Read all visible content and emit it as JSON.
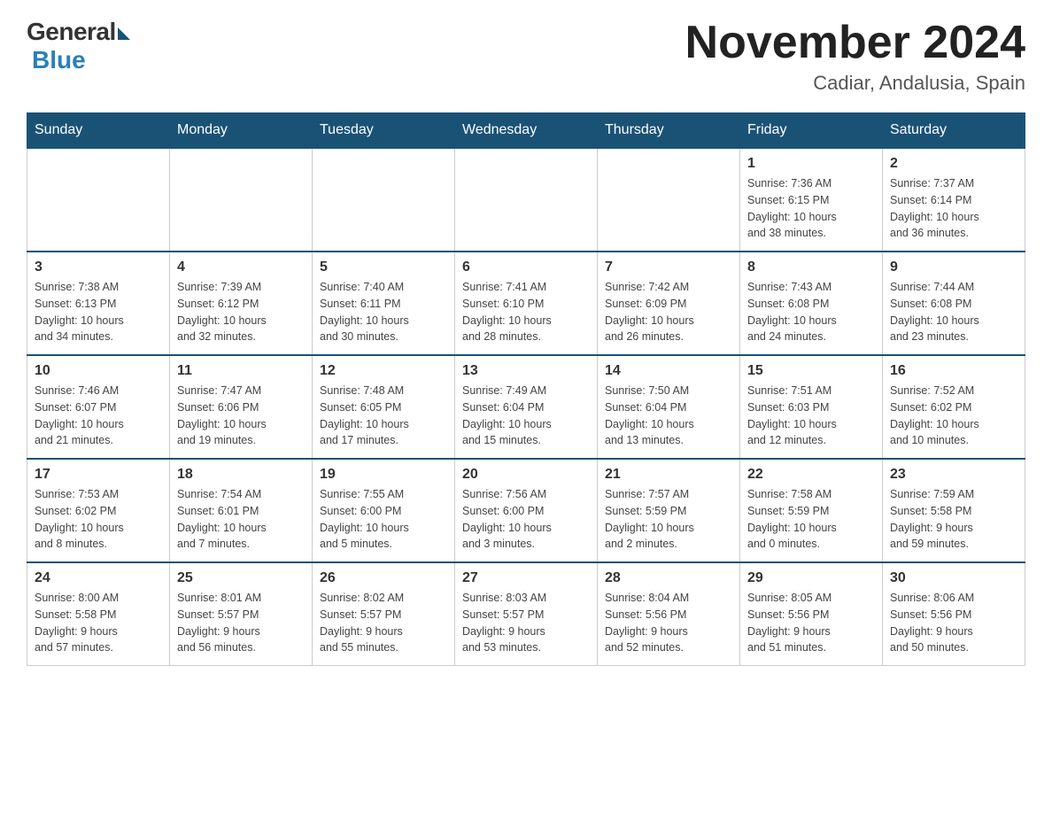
{
  "logo": {
    "general": "General",
    "blue": "Blue"
  },
  "title": "November 2024",
  "subtitle": "Cadiar, Andalusia, Spain",
  "weekdays": [
    "Sunday",
    "Monday",
    "Tuesday",
    "Wednesday",
    "Thursday",
    "Friday",
    "Saturday"
  ],
  "weeks": [
    [
      {
        "day": "",
        "info": ""
      },
      {
        "day": "",
        "info": ""
      },
      {
        "day": "",
        "info": ""
      },
      {
        "day": "",
        "info": ""
      },
      {
        "day": "",
        "info": ""
      },
      {
        "day": "1",
        "info": "Sunrise: 7:36 AM\nSunset: 6:15 PM\nDaylight: 10 hours\nand 38 minutes."
      },
      {
        "day": "2",
        "info": "Sunrise: 7:37 AM\nSunset: 6:14 PM\nDaylight: 10 hours\nand 36 minutes."
      }
    ],
    [
      {
        "day": "3",
        "info": "Sunrise: 7:38 AM\nSunset: 6:13 PM\nDaylight: 10 hours\nand 34 minutes."
      },
      {
        "day": "4",
        "info": "Sunrise: 7:39 AM\nSunset: 6:12 PM\nDaylight: 10 hours\nand 32 minutes."
      },
      {
        "day": "5",
        "info": "Sunrise: 7:40 AM\nSunset: 6:11 PM\nDaylight: 10 hours\nand 30 minutes."
      },
      {
        "day": "6",
        "info": "Sunrise: 7:41 AM\nSunset: 6:10 PM\nDaylight: 10 hours\nand 28 minutes."
      },
      {
        "day": "7",
        "info": "Sunrise: 7:42 AM\nSunset: 6:09 PM\nDaylight: 10 hours\nand 26 minutes."
      },
      {
        "day": "8",
        "info": "Sunrise: 7:43 AM\nSunset: 6:08 PM\nDaylight: 10 hours\nand 24 minutes."
      },
      {
        "day": "9",
        "info": "Sunrise: 7:44 AM\nSunset: 6:08 PM\nDaylight: 10 hours\nand 23 minutes."
      }
    ],
    [
      {
        "day": "10",
        "info": "Sunrise: 7:46 AM\nSunset: 6:07 PM\nDaylight: 10 hours\nand 21 minutes."
      },
      {
        "day": "11",
        "info": "Sunrise: 7:47 AM\nSunset: 6:06 PM\nDaylight: 10 hours\nand 19 minutes."
      },
      {
        "day": "12",
        "info": "Sunrise: 7:48 AM\nSunset: 6:05 PM\nDaylight: 10 hours\nand 17 minutes."
      },
      {
        "day": "13",
        "info": "Sunrise: 7:49 AM\nSunset: 6:04 PM\nDaylight: 10 hours\nand 15 minutes."
      },
      {
        "day": "14",
        "info": "Sunrise: 7:50 AM\nSunset: 6:04 PM\nDaylight: 10 hours\nand 13 minutes."
      },
      {
        "day": "15",
        "info": "Sunrise: 7:51 AM\nSunset: 6:03 PM\nDaylight: 10 hours\nand 12 minutes."
      },
      {
        "day": "16",
        "info": "Sunrise: 7:52 AM\nSunset: 6:02 PM\nDaylight: 10 hours\nand 10 minutes."
      }
    ],
    [
      {
        "day": "17",
        "info": "Sunrise: 7:53 AM\nSunset: 6:02 PM\nDaylight: 10 hours\nand 8 minutes."
      },
      {
        "day": "18",
        "info": "Sunrise: 7:54 AM\nSunset: 6:01 PM\nDaylight: 10 hours\nand 7 minutes."
      },
      {
        "day": "19",
        "info": "Sunrise: 7:55 AM\nSunset: 6:00 PM\nDaylight: 10 hours\nand 5 minutes."
      },
      {
        "day": "20",
        "info": "Sunrise: 7:56 AM\nSunset: 6:00 PM\nDaylight: 10 hours\nand 3 minutes."
      },
      {
        "day": "21",
        "info": "Sunrise: 7:57 AM\nSunset: 5:59 PM\nDaylight: 10 hours\nand 2 minutes."
      },
      {
        "day": "22",
        "info": "Sunrise: 7:58 AM\nSunset: 5:59 PM\nDaylight: 10 hours\nand 0 minutes."
      },
      {
        "day": "23",
        "info": "Sunrise: 7:59 AM\nSunset: 5:58 PM\nDaylight: 9 hours\nand 59 minutes."
      }
    ],
    [
      {
        "day": "24",
        "info": "Sunrise: 8:00 AM\nSunset: 5:58 PM\nDaylight: 9 hours\nand 57 minutes."
      },
      {
        "day": "25",
        "info": "Sunrise: 8:01 AM\nSunset: 5:57 PM\nDaylight: 9 hours\nand 56 minutes."
      },
      {
        "day": "26",
        "info": "Sunrise: 8:02 AM\nSunset: 5:57 PM\nDaylight: 9 hours\nand 55 minutes."
      },
      {
        "day": "27",
        "info": "Sunrise: 8:03 AM\nSunset: 5:57 PM\nDaylight: 9 hours\nand 53 minutes."
      },
      {
        "day": "28",
        "info": "Sunrise: 8:04 AM\nSunset: 5:56 PM\nDaylight: 9 hours\nand 52 minutes."
      },
      {
        "day": "29",
        "info": "Sunrise: 8:05 AM\nSunset: 5:56 PM\nDaylight: 9 hours\nand 51 minutes."
      },
      {
        "day": "30",
        "info": "Sunrise: 8:06 AM\nSunset: 5:56 PM\nDaylight: 9 hours\nand 50 minutes."
      }
    ]
  ]
}
